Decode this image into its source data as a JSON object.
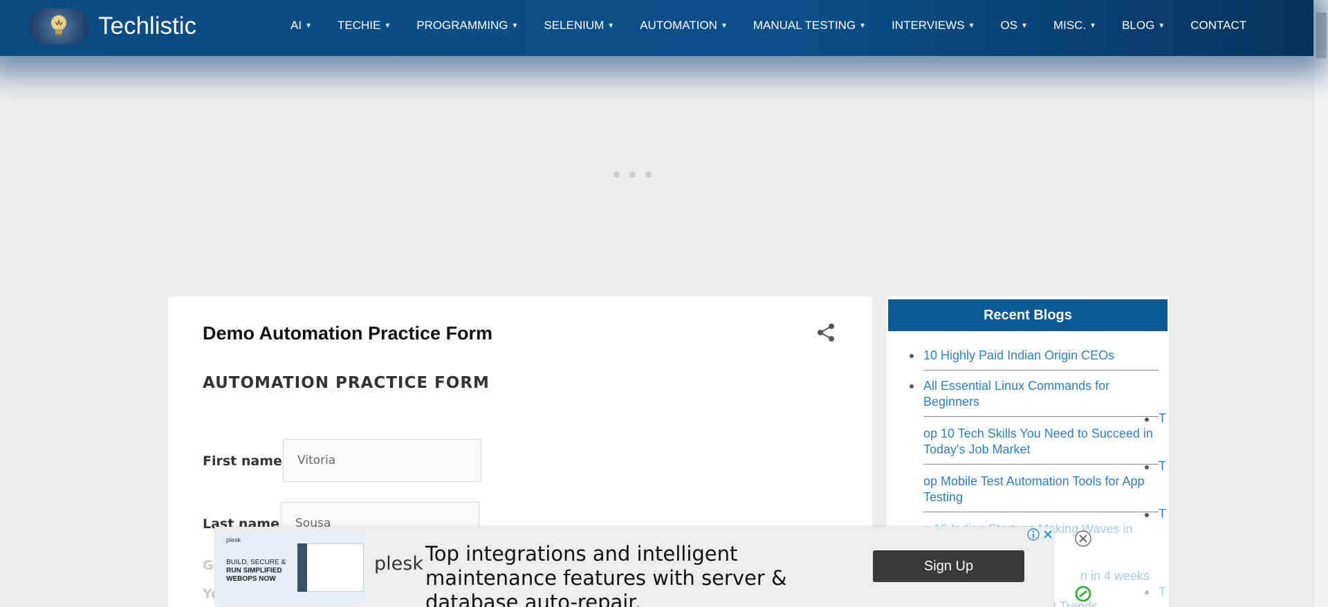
{
  "header": {
    "brand": "Techlistic",
    "nav": [
      {
        "label": "AI",
        "dropdown": true
      },
      {
        "label": "TECHIE",
        "dropdown": true
      },
      {
        "label": "PROGRAMMING",
        "dropdown": true
      },
      {
        "label": "SELENIUM",
        "dropdown": true
      },
      {
        "label": "AUTOMATION",
        "dropdown": true
      },
      {
        "label": "MANUAL TESTING",
        "dropdown": true
      },
      {
        "label": "INTERVIEWS",
        "dropdown": true
      },
      {
        "label": "OS",
        "dropdown": true
      },
      {
        "label": "MISC.",
        "dropdown": true
      },
      {
        "label": "BLOG",
        "dropdown": true
      },
      {
        "label": "CONTACT",
        "dropdown": false
      }
    ]
  },
  "post": {
    "title": "Demo Automation Practice Form",
    "form_heading": "AUTOMATION PRACTICE FORM",
    "fields": {
      "first_name": {
        "label": "First name:",
        "value": "Vitoria"
      },
      "last_name": {
        "label": "Last name:",
        "value": "Sousa"
      }
    },
    "partial_labels": [
      "Ge",
      "Ye"
    ]
  },
  "sidebar": {
    "title": "Recent Blogs",
    "items": [
      "10 Highly Paid Indian Origin CEOs",
      "All Essential Linux Commands for Beginners",
      "op 10 Tech Skills You Need to Succeed in Today's Job Market",
      "op Mobile Test Automation Tools for App Testing",
      "o 10 Indian Startups Making Waves in",
      "n in 4 weeks",
      "op Python Development Trends"
    ],
    "stray_letter": "T"
  },
  "ad": {
    "thumb_brand": "plesk",
    "thumb_text": [
      "BUILD, SECURE &",
      "RUN SIMPLIFIED",
      "WEBOPS NOW"
    ],
    "logo": "plesk",
    "headline": "Top integrations and intelligent maintenance features with server & database auto-repair.",
    "cta": "Sign Up"
  },
  "colors": {
    "header_bg": "#0b4f8a",
    "sidebar_header_bg": "#0a5a96",
    "link": "#2f7fc6",
    "page_bg": "#ececec",
    "cta_bg": "#3a3a3a"
  }
}
